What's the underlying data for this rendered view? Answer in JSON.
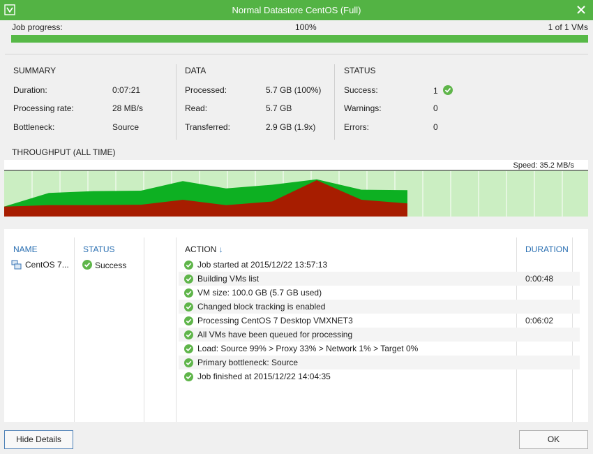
{
  "window": {
    "title": "Normal Datastore CentOS (Full)"
  },
  "progress": {
    "label": "Job progress:",
    "percent_text": "100%",
    "value": 1.0,
    "count_text": "1 of 1 VMs"
  },
  "summary": {
    "heading": "SUMMARY",
    "rows": [
      {
        "label": "Duration:",
        "value": "0:07:21"
      },
      {
        "label": "Processing rate:",
        "value": "28 MB/s"
      },
      {
        "label": "Bottleneck:",
        "value": "Source"
      }
    ]
  },
  "data_section": {
    "heading": "DATA",
    "rows": [
      {
        "label": "Processed:",
        "value": "5.7 GB (100%)"
      },
      {
        "label": "Read:",
        "value": "5.7 GB"
      },
      {
        "label": "Transferred:",
        "value": "2.9 GB (1.9x)"
      }
    ]
  },
  "status_section": {
    "heading": "STATUS",
    "rows": [
      {
        "label": "Success:",
        "value": "1"
      },
      {
        "label": "Warnings:",
        "value": "0"
      },
      {
        "label": "Errors:",
        "value": "0"
      }
    ]
  },
  "throughput": {
    "title": "THROUGHPUT (ALL TIME)",
    "speed_text": "Speed: 35.2 MB/s"
  },
  "chart_data": {
    "type": "area",
    "title": "THROUGHPUT (ALL TIME)",
    "grid": true,
    "series": [
      {
        "values": [
          0.22,
          0.52,
          0.56,
          0.57,
          0.78,
          0.62,
          0.7,
          0.82,
          0.59,
          0.58
        ]
      },
      {
        "values": [
          0.22,
          0.25,
          0.25,
          0.26,
          0.37,
          0.25,
          0.33,
          0.8,
          0.37,
          0.29
        ]
      }
    ],
    "colors": {
      "processed": "#0db022",
      "read": "#a71d00",
      "background": "#cbeec2",
      "grid": "#ffffff"
    }
  },
  "details": {
    "headers": {
      "name": "NAME",
      "status": "STATUS",
      "action": "ACTION",
      "duration": "DURATION"
    },
    "sort_arrow": "↓",
    "vm": {
      "name": "CentOS 7...",
      "status": "Success"
    },
    "actions": [
      {
        "text": "Job started at 2015/12/22 13:57:13",
        "duration": ""
      },
      {
        "text": "Building VMs list",
        "duration": "0:00:48"
      },
      {
        "text": "VM size: 100.0 GB (5.7 GB used)",
        "duration": ""
      },
      {
        "text": "Changed block tracking is enabled",
        "duration": ""
      },
      {
        "text": "Processing CentOS 7 Desktop VMXNET3",
        "duration": "0:06:02"
      },
      {
        "text": "All VMs have been queued for processing",
        "duration": ""
      },
      {
        "text": "Load: Source 99% > Proxy 33% > Network 1% > Target 0%",
        "duration": ""
      },
      {
        "text": "Primary bottleneck: Source",
        "duration": ""
      },
      {
        "text": "Job finished at 2015/12/22 14:04:35",
        "duration": ""
      }
    ]
  },
  "buttons": {
    "hide_details": "Hide Details",
    "ok": "OK"
  },
  "colors": {
    "accent": "#53b344",
    "success": "#5fb54a",
    "link": "#2a6fb2"
  }
}
